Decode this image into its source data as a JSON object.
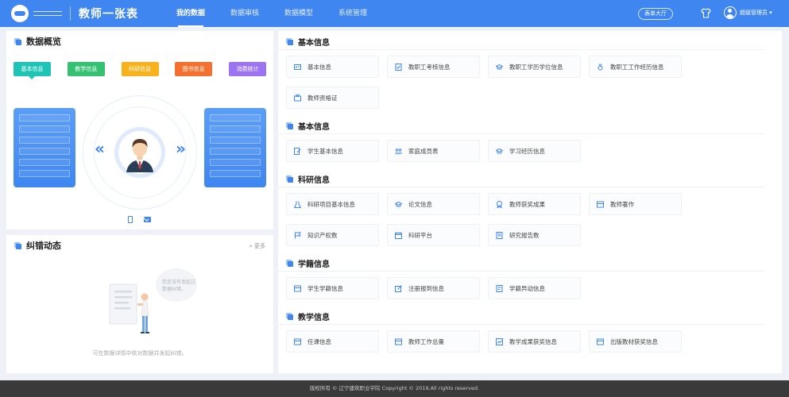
{
  "header": {
    "title": "教师一张表",
    "nav": [
      {
        "label": "我的数据",
        "active": true
      },
      {
        "label": "数据审核",
        "active": false
      },
      {
        "label": "数据模型",
        "active": false
      },
      {
        "label": "系统管理",
        "active": false
      }
    ],
    "hall_button": "表单大厅",
    "user_name": "超级管理员"
  },
  "overview": {
    "title": "数据概览",
    "tabs": [
      {
        "label": "基本信息",
        "color": "#1ec4b6"
      },
      {
        "label": "教学信息",
        "color": "#34c172"
      },
      {
        "label": "科研信息",
        "color": "#f7b21c"
      },
      {
        "label": "图书信息",
        "color": "#f4702f"
      },
      {
        "label": "消费统计",
        "color": "#9c74f1"
      }
    ]
  },
  "errata": {
    "title": "纠错动态",
    "more": "» 更多",
    "bubble_text": "您还没有发起过数据纠错。",
    "empty_note": "可在数据详情中核对数据并发起纠错。"
  },
  "sections": [
    {
      "title": "基本信息",
      "items": [
        "基本信息",
        "教职工考核信息",
        "教职工学历学位信息",
        "教职工工作经历信息",
        "教师资格证"
      ]
    },
    {
      "title": "基本信息",
      "items": [
        "学生基本信息",
        "家庭成员表",
        "学习经历信息"
      ]
    },
    {
      "title": "科研信息",
      "items": [
        "科研项目基本信息",
        "论文信息",
        "教师获奖成果",
        "教师著作",
        "知识产权数",
        "科研平台",
        "研究报告数"
      ]
    },
    {
      "title": "学籍信息",
      "items": [
        "学生学籍信息",
        "注册报到信息",
        "学籍异动信息"
      ]
    },
    {
      "title": "教学信息",
      "items": [
        "任课信息",
        "教师工作总量",
        "教学成果获奖信息",
        "出版教材获奖信息"
      ]
    }
  ],
  "footer": "版权所有 © 辽宁建筑职业学院 Copyright © 2019,All rights reserved."
}
